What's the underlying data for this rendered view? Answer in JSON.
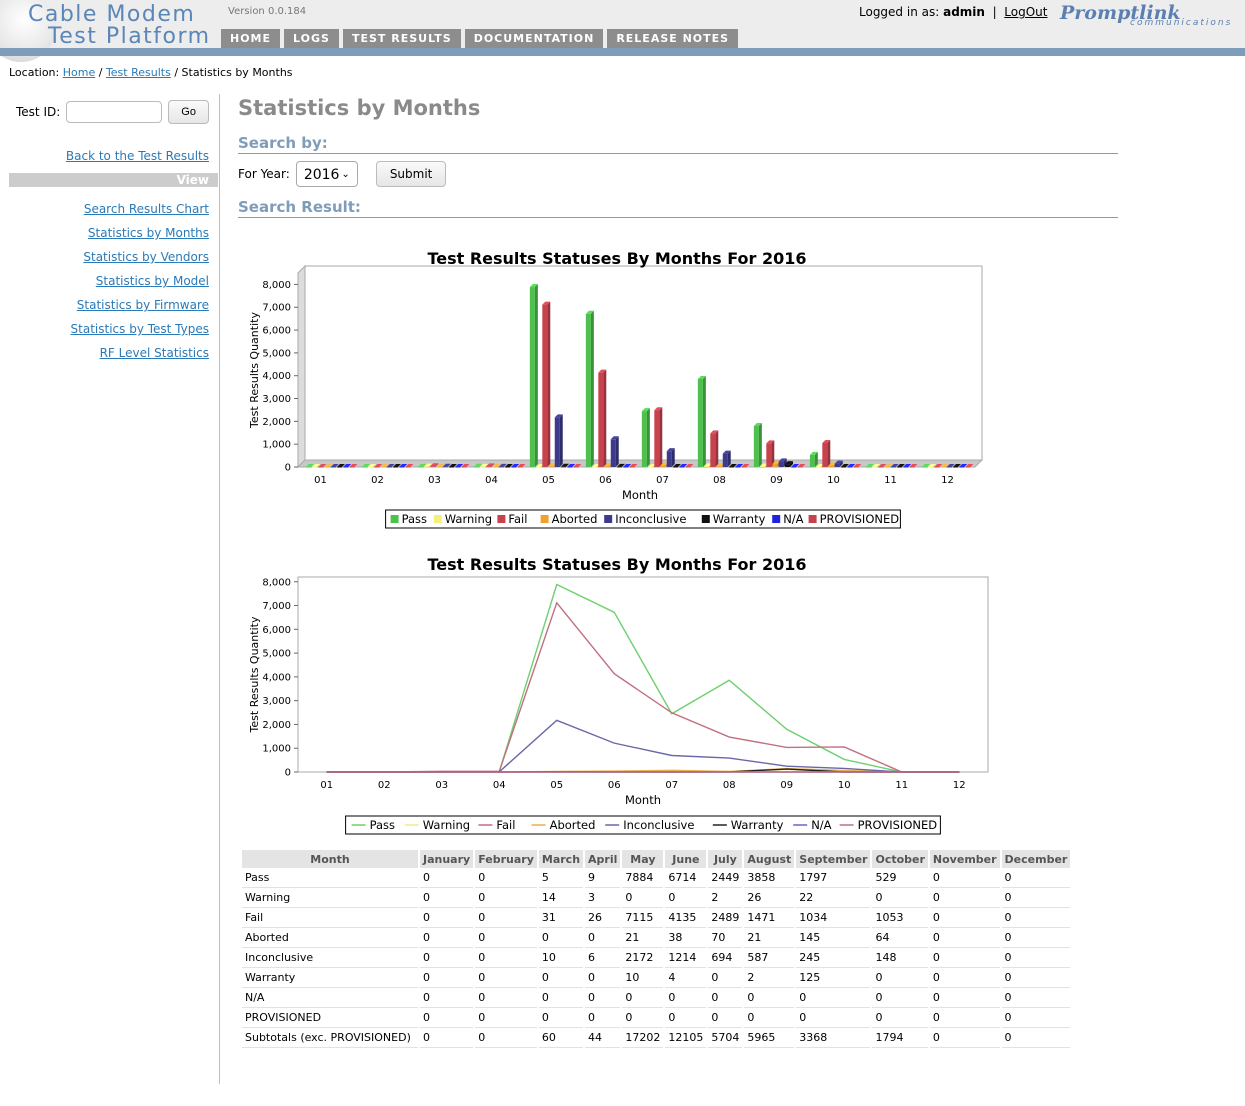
{
  "header": {
    "logo_line1": "Cable Modem",
    "logo_line2": "Test Platform",
    "version": "Version 0.0.184",
    "nav": [
      "HOME",
      "LOGS",
      "TEST RESULTS",
      "DOCUMENTATION",
      "RELEASE NOTES"
    ],
    "logged_in_label": "Logged in as:",
    "user": "admin",
    "separator": "|",
    "logout": "LogOut",
    "brand": "Promptlink",
    "brand_sub": "communications"
  },
  "breadcrumb": {
    "prefix": "Location:",
    "home": "Home",
    "sep": "/",
    "results": "Test Results",
    "current": "Statistics by Months"
  },
  "sidebar": {
    "testid_label": "Test ID:",
    "go": "Go",
    "back": "Back to the Test Results",
    "view": "View",
    "links": [
      "Search Results Chart",
      "Statistics by Months",
      "Statistics by Vendors",
      "Statistics by Model",
      "Statistics by Firmware",
      "Statistics by Test Types",
      "RF Level Statistics"
    ]
  },
  "main": {
    "title": "Statistics by Months",
    "search_by": "Search by:",
    "year_label": "For Year:",
    "year_value": "2016",
    "submit": "Submit",
    "search_result": "Search Result:"
  },
  "chart_data": [
    {
      "type": "bar",
      "title": "Test Results Statuses By Months For 2016",
      "xlabel": "Month",
      "ylabel": "Test Results Quantity",
      "ylim": [
        0,
        8500
      ],
      "yticks": [
        0,
        1000,
        2000,
        3000,
        4000,
        5000,
        6000,
        7000,
        8000
      ],
      "ytick_labels": [
        "0",
        "1,000",
        "2,000",
        "3,000",
        "4,000",
        "5,000",
        "6,000",
        "7,000",
        "8,000"
      ],
      "categories": [
        "01",
        "02",
        "03",
        "04",
        "05",
        "06",
        "07",
        "08",
        "09",
        "10",
        "11",
        "12"
      ],
      "series": [
        {
          "name": "Pass",
          "color": "#4cc24c",
          "values": [
            0,
            0,
            5,
            9,
            7884,
            6714,
            2449,
            3858,
            1797,
            529,
            0,
            0
          ]
        },
        {
          "name": "Warning",
          "color": "#f5f07a",
          "values": [
            0,
            0,
            14,
            3,
            0,
            0,
            2,
            26,
            22,
            0,
            0,
            0
          ]
        },
        {
          "name": "Fail",
          "color": "#c8424e",
          "values": [
            0,
            0,
            31,
            26,
            7115,
            4135,
            2489,
            1471,
            1034,
            1053,
            0,
            0
          ]
        },
        {
          "name": "Aborted",
          "color": "#f0a030",
          "values": [
            0,
            0,
            0,
            0,
            21,
            38,
            70,
            21,
            145,
            64,
            0,
            0
          ]
        },
        {
          "name": "Inconclusive",
          "color": "#3d3a8c",
          "values": [
            0,
            0,
            10,
            6,
            2172,
            1214,
            694,
            587,
            245,
            148,
            0,
            0
          ]
        },
        {
          "name": "Warranty",
          "color": "#111111",
          "values": [
            0,
            0,
            0,
            0,
            10,
            4,
            0,
            2,
            125,
            0,
            0,
            0
          ]
        },
        {
          "name": "N/A",
          "color": "#2222dd",
          "values": [
            0,
            0,
            0,
            0,
            0,
            0,
            0,
            0,
            0,
            0,
            0,
            0
          ]
        },
        {
          "name": "PROVISIONED",
          "color": "#c8424e",
          "values": [
            0,
            0,
            0,
            0,
            0,
            0,
            0,
            0,
            0,
            0,
            0,
            0
          ]
        }
      ],
      "legend": "bottom"
    },
    {
      "type": "line",
      "title": "Test Results Statuses By Months For 2016",
      "xlabel": "Month",
      "ylabel": "Test Results Quantity",
      "ylim": [
        0,
        8200
      ],
      "yticks": [
        0,
        1000,
        2000,
        3000,
        4000,
        5000,
        6000,
        7000,
        8000
      ],
      "ytick_labels": [
        "0",
        "1,000",
        "2,000",
        "3,000",
        "4,000",
        "5,000",
        "6,000",
        "7,000",
        "8,000"
      ],
      "categories": [
        "01",
        "02",
        "03",
        "04",
        "05",
        "06",
        "07",
        "08",
        "09",
        "10",
        "11",
        "12"
      ],
      "series": [
        {
          "name": "Pass",
          "color": "#6ed06e",
          "values": [
            0,
            0,
            5,
            9,
            7884,
            6714,
            2449,
            3858,
            1797,
            529,
            0,
            0
          ]
        },
        {
          "name": "Warning",
          "color": "#f0ea90",
          "values": [
            0,
            0,
            14,
            3,
            0,
            0,
            2,
            26,
            22,
            0,
            0,
            0
          ]
        },
        {
          "name": "Fail",
          "color": "#c07080",
          "values": [
            0,
            0,
            31,
            26,
            7115,
            4135,
            2489,
            1471,
            1034,
            1053,
            0,
            0
          ]
        },
        {
          "name": "Aborted",
          "color": "#e8b050",
          "values": [
            0,
            0,
            0,
            0,
            21,
            38,
            70,
            21,
            145,
            64,
            0,
            0
          ]
        },
        {
          "name": "Inconclusive",
          "color": "#6868a8",
          "values": [
            0,
            0,
            10,
            6,
            2172,
            1214,
            694,
            587,
            245,
            148,
            0,
            0
          ]
        },
        {
          "name": "Warranty",
          "color": "#222222",
          "values": [
            0,
            0,
            0,
            0,
            10,
            4,
            0,
            2,
            125,
            0,
            0,
            0
          ]
        },
        {
          "name": "N/A",
          "color": "#6666cc",
          "values": [
            0,
            0,
            0,
            0,
            0,
            0,
            0,
            0,
            0,
            0,
            0,
            0
          ]
        },
        {
          "name": "PROVISIONED",
          "color": "#c07080",
          "values": [
            0,
            0,
            0,
            0,
            0,
            0,
            0,
            0,
            0,
            0,
            0,
            0
          ]
        }
      ],
      "legend": "bottom"
    }
  ],
  "table": {
    "headers": [
      "Month",
      "January",
      "February",
      "March",
      "April",
      "May",
      "June",
      "July",
      "August",
      "September",
      "October",
      "November",
      "December"
    ],
    "rows": [
      [
        "Pass",
        "0",
        "0",
        "5",
        "9",
        "7884",
        "6714",
        "2449",
        "3858",
        "1797",
        "529",
        "0",
        "0"
      ],
      [
        "Warning",
        "0",
        "0",
        "14",
        "3",
        "0",
        "0",
        "2",
        "26",
        "22",
        "0",
        "0",
        "0"
      ],
      [
        "Fail",
        "0",
        "0",
        "31",
        "26",
        "7115",
        "4135",
        "2489",
        "1471",
        "1034",
        "1053",
        "0",
        "0"
      ],
      [
        "Aborted",
        "0",
        "0",
        "0",
        "0",
        "21",
        "38",
        "70",
        "21",
        "145",
        "64",
        "0",
        "0"
      ],
      [
        "Inconclusive",
        "0",
        "0",
        "10",
        "6",
        "2172",
        "1214",
        "694",
        "587",
        "245",
        "148",
        "0",
        "0"
      ],
      [
        "Warranty",
        "0",
        "0",
        "0",
        "0",
        "10",
        "4",
        "0",
        "2",
        "125",
        "0",
        "0",
        "0"
      ],
      [
        "N/A",
        "0",
        "0",
        "0",
        "0",
        "0",
        "0",
        "0",
        "0",
        "0",
        "0",
        "0",
        "0"
      ],
      [
        "PROVISIONED",
        "0",
        "0",
        "0",
        "0",
        "0",
        "0",
        "0",
        "0",
        "0",
        "0",
        "0",
        "0"
      ],
      [
        "Subtotals (exc. PROVISIONED)",
        "0",
        "0",
        "60",
        "44",
        "17202",
        "12105",
        "5704",
        "5965",
        "3368",
        "1794",
        "0",
        "0"
      ]
    ]
  }
}
